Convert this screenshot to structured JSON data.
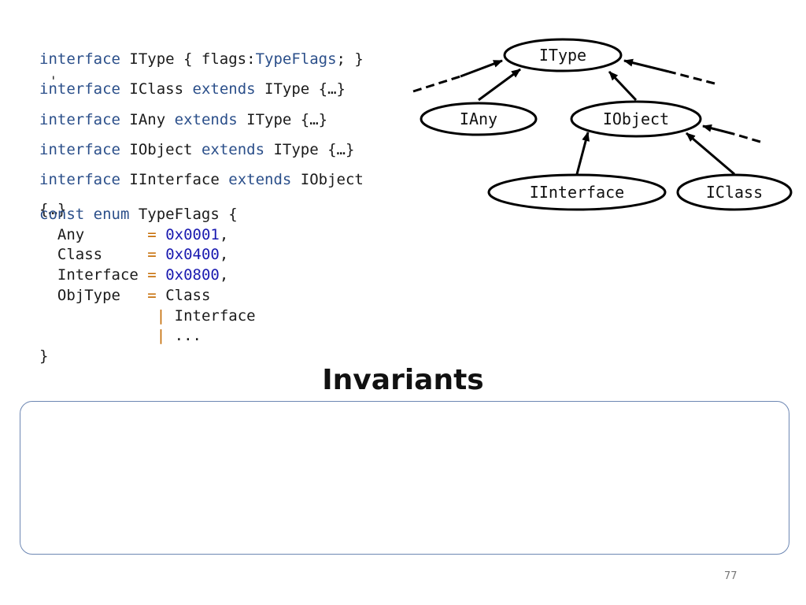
{
  "declarations": [
    {
      "kw1": "interface",
      "name": "IType { flags:",
      "type": "TypeFlags",
      "tail": "; }"
    },
    {
      "kw1": "interface",
      "name": "IClass",
      "kw2": "extends",
      "base": "IType {…}"
    },
    {
      "kw1": "interface",
      "name": "IAny",
      "kw2": "extends",
      "base": "IType {…}"
    },
    {
      "kw1": "interface",
      "name": "IObject",
      "kw2": "extends",
      "base": "IType {…}"
    },
    {
      "kw1": "interface",
      "name": "IInterface",
      "kw2": "extends",
      "base": "IObject",
      "wrap": "{…}"
    }
  ],
  "enum": {
    "head_kw": "const enum",
    "name": "TypeFlags {",
    "members": [
      {
        "name": "Any",
        "eq": "=",
        "value": "0x0001",
        "end": ","
      },
      {
        "name": "Class",
        "eq": "=",
        "value": "0x0400",
        "end": ","
      },
      {
        "name": "Interface",
        "eq": "=",
        "value": "0x0800",
        "end": ","
      },
      {
        "name": "ObjType",
        "eq": "=",
        "value": "Class"
      }
    ],
    "continuations": [
      {
        "op": "|",
        "value": "Interface"
      },
      {
        "op": "|",
        "value": "..."
      }
    ],
    "close": "}"
  },
  "diagram": {
    "nodes": {
      "itype": "IType",
      "iany": "IAny",
      "iobject": "IObject",
      "iinterface": "IInterface",
      "iclass": "IClass"
    }
  },
  "title": "Invariants",
  "page_number": "77"
}
